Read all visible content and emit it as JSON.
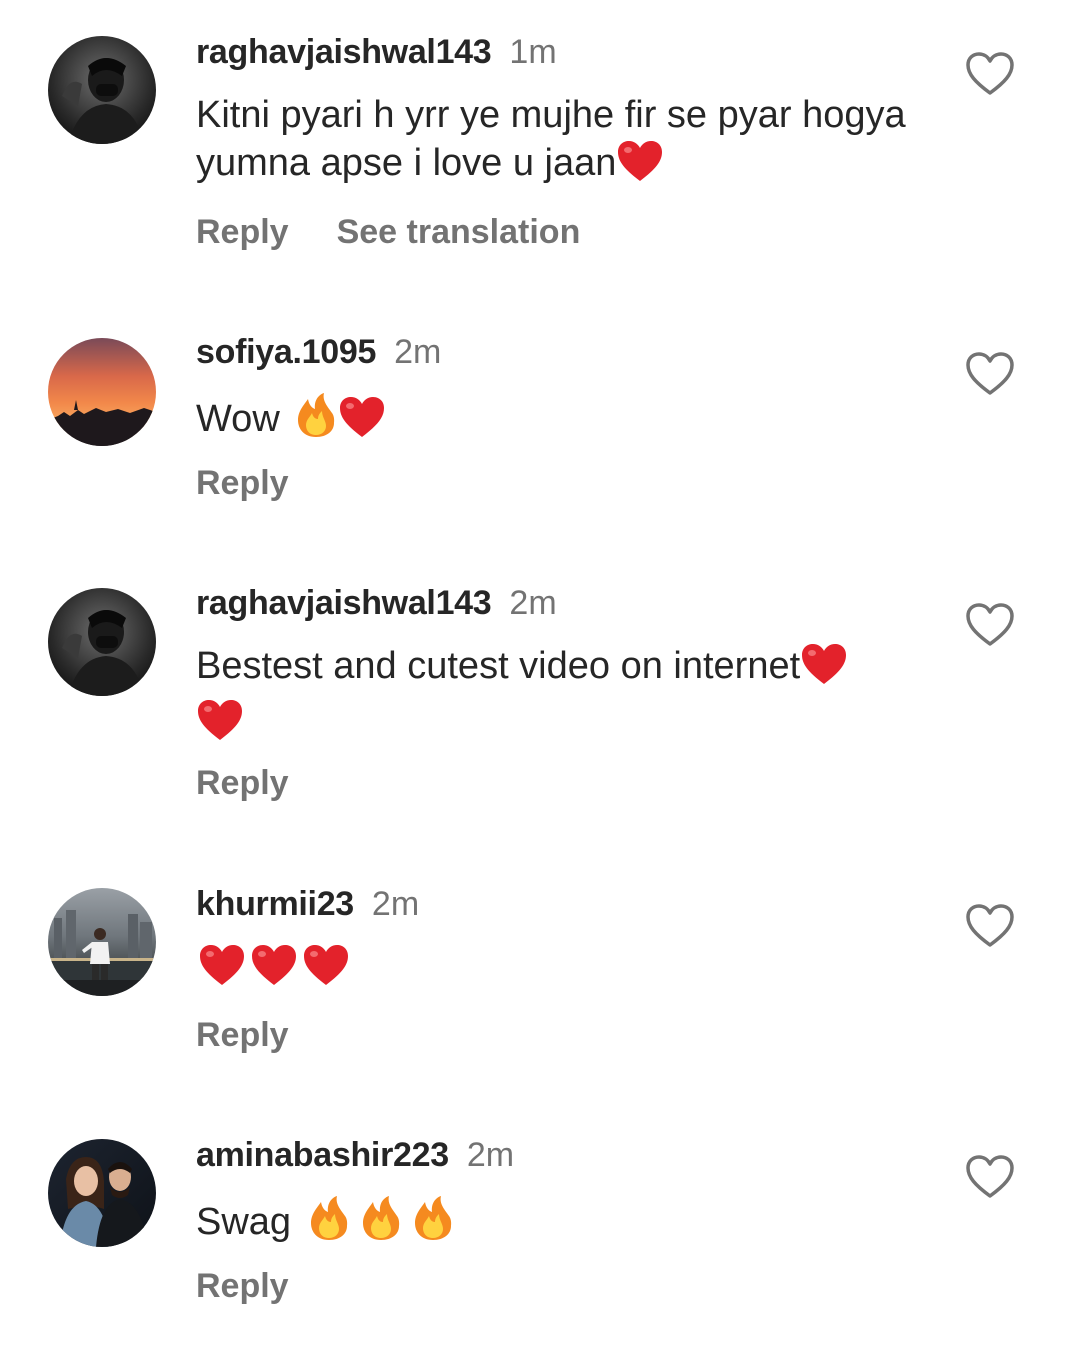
{
  "comments": [
    {
      "username": "raghavjaishwal143",
      "time": "1m",
      "text": "Kitni pyari h yrr ye mujhe fir se pyar hogya yumna apse i love u jaan",
      "emojis": [
        "red-heart"
      ],
      "reply_label": "Reply",
      "translation_label": "See translation",
      "avatar": "dark-portrait"
    },
    {
      "username": "sofiya.1095",
      "time": "2m",
      "text": "Wow",
      "emojis": [
        "fire",
        "red-heart"
      ],
      "reply_label": "Reply",
      "avatar": "sunset"
    },
    {
      "username": "raghavjaishwal143",
      "time": "2m",
      "text": "Bestest and cutest video on internet",
      "emojis": [
        "red-heart",
        "red-heart"
      ],
      "reply_label": "Reply",
      "avatar": "dark-portrait"
    },
    {
      "username": "khurmii23",
      "time": "2m",
      "text": "",
      "emojis": [
        "red-heart",
        "red-heart",
        "red-heart"
      ],
      "reply_label": "Reply",
      "avatar": "city-night"
    },
    {
      "username": "aminabashir223",
      "time": "2m",
      "text": "Swag",
      "emojis": [
        "fire",
        "fire",
        "fire"
      ],
      "reply_label": "Reply",
      "avatar": "couple"
    }
  ],
  "colors": {
    "username": "#262626",
    "secondary": "#737373",
    "heart_emoji": "#e3222b",
    "fire_outer": "#f58a1f",
    "fire_inner": "#ffd23f"
  },
  "icons": {
    "like": "heart-outline-icon"
  }
}
